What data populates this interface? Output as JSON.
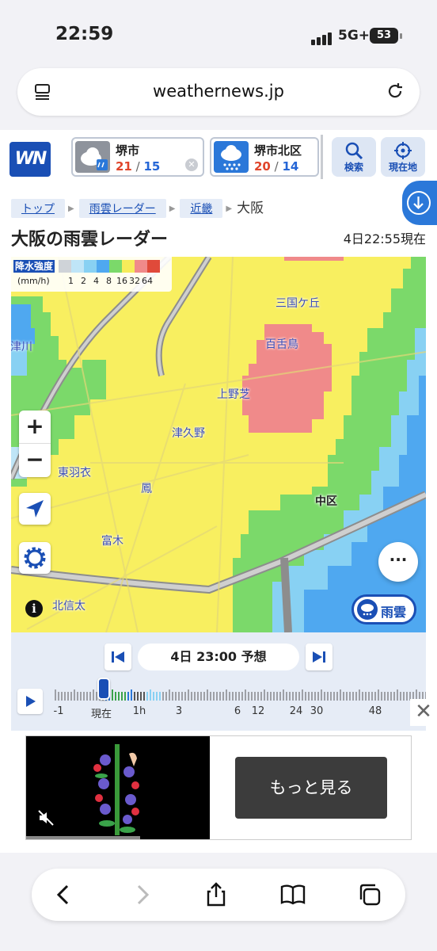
{
  "status_bar": {
    "time": "22:59",
    "network": "5G+",
    "battery": "53"
  },
  "browser": {
    "url": "weathernews.jp"
  },
  "header": {
    "logo": "WN",
    "locations": [
      {
        "name": "堺市",
        "high": "21",
        "low": "15",
        "weather_icon": "cloud-rain-icon"
      },
      {
        "name": "堺市北区",
        "high": "20",
        "low": "14",
        "weather_icon": "rain-icon"
      }
    ],
    "search_label": "検索",
    "current_location_label": "現在地"
  },
  "breadcrumb": {
    "items": [
      "トップ",
      "雨雲レーダー",
      "近畿"
    ],
    "current": "大阪"
  },
  "page": {
    "title": "大阪の雨雲レーダー",
    "timestamp": "4日22:55現在"
  },
  "legend": {
    "title": "降水強度",
    "unit": "(mm/h)",
    "ticks": [
      "1",
      "2",
      "4",
      "8",
      "16",
      "32",
      "64"
    ],
    "colors": [
      "#cfd3d8",
      "#bfe5f7",
      "#88d1f3",
      "#4fa8f0",
      "#7bd96a",
      "#f6ec5a",
      "#f08a8a",
      "#e04a3a"
    ]
  },
  "map_labels": [
    "三国ケ丘",
    "百舌鳥",
    "上野芝",
    "津久野",
    "東羽衣",
    "鳳",
    "中区",
    "富木",
    "北信太",
    "津川"
  ],
  "map_buttons": {
    "rain_label": "雨雲"
  },
  "timeline": {
    "current_time": "4日 23:00 予想",
    "scale_labels": [
      "-1",
      "現在",
      "1h",
      "3",
      "6",
      "12",
      "24",
      "30",
      "48"
    ]
  },
  "ad": {
    "cta": "もっと見る"
  }
}
